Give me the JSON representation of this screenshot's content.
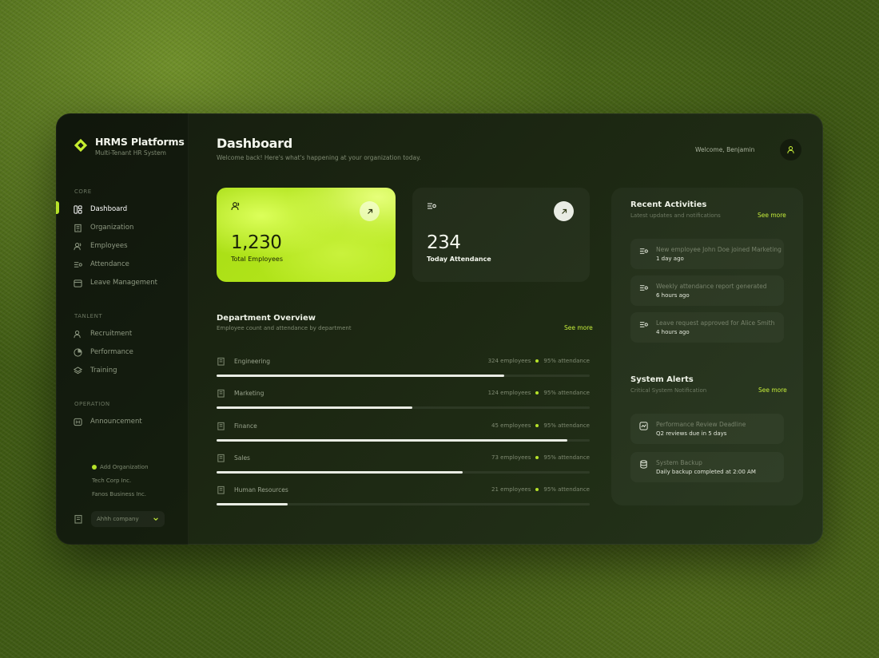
{
  "brand": {
    "title": "HRMS Platforms",
    "subtitle": "Multi-Tenant HR System"
  },
  "sidebar": {
    "sections": [
      {
        "label": "CORE",
        "items": [
          "Dashboard",
          "Organization",
          "Employees",
          "Attendance",
          "Leave Management"
        ]
      },
      {
        "label": "TANLENT",
        "items": [
          "Recruitment",
          "Performance",
          "Training"
        ]
      },
      {
        "label": "OPERATION",
        "items": [
          "Announcement"
        ]
      }
    ],
    "active_item": "Dashboard",
    "orgs": [
      "Add Organization",
      "Tech Corp Inc.",
      "Fanos Business Inc."
    ],
    "company_select": "Ahhh company"
  },
  "header": {
    "title": "Dashboard",
    "subtitle": "Welcome back! Here's what's happening at your organization today.",
    "welcome": "Welcome, Benjamin"
  },
  "stats": [
    {
      "value": "1,230",
      "label": "Total Employees"
    },
    {
      "value": "234",
      "label": "Today Attendance"
    }
  ],
  "department_overview": {
    "title": "Department Overview",
    "subtitle": "Employee count and attendance by department",
    "see_more": "See more",
    "rows": [
      {
        "name": "Engineering",
        "employees": "324 employees",
        "attendance": "95% attendance",
        "progress": 0.77
      },
      {
        "name": "Marketing",
        "employees": "124 employees",
        "attendance": "95% attendance",
        "progress": 0.525
      },
      {
        "name": "Finance",
        "employees": "45 employees",
        "attendance": "95% attendance",
        "progress": 0.94
      },
      {
        "name": "Sales",
        "employees": "73 employees",
        "attendance": "95% attendance",
        "progress": 0.66
      },
      {
        "name": "Human Resources",
        "employees": "21 employees",
        "attendance": "95% attendance",
        "progress": 0.19
      }
    ]
  },
  "recent_activities": {
    "title": "Recent Activities",
    "subtitle": "Latest updates and notifications",
    "see_more": "See more",
    "items": [
      {
        "text": "New employee John Doe joined Marketing",
        "time": "1 day ago"
      },
      {
        "text": "Weekly attendance report generated",
        "time": "6 hours ago"
      },
      {
        "text": "Leave request approved for Alice Smith",
        "time": "4 hours ago"
      }
    ]
  },
  "system_alerts": {
    "title": "System Alerts",
    "subtitle": "Critical System Notification",
    "see_more": "See more",
    "items": [
      {
        "text": "Performance Review Deadline",
        "time": "Q2 reviews due in 5 days"
      },
      {
        "text": "System Backup",
        "time": "Daily backup completed at 2:00 AM"
      }
    ]
  },
  "colors": {
    "accent": "#b6e22a",
    "panel": "#1c2712",
    "text": "#eef2e7"
  }
}
